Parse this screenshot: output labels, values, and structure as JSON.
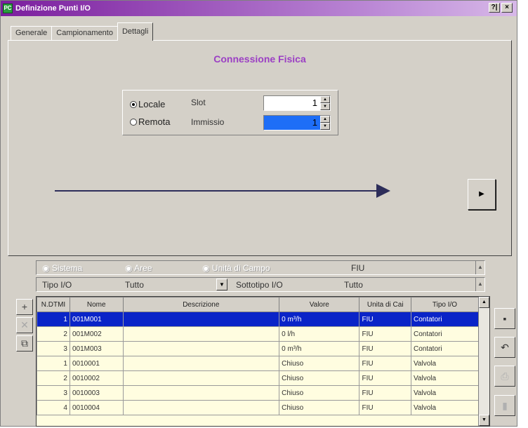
{
  "window": {
    "title": "Definizione Punti I/O",
    "help_label": "?|",
    "close_label": "×"
  },
  "tabs": [
    {
      "label": "Generale"
    },
    {
      "label": "Campionamento"
    },
    {
      "label": "Dettagli"
    }
  ],
  "details": {
    "heading": "Connessione Fisica",
    "options": [
      {
        "label": "Locale",
        "checked": true
      },
      {
        "label": "Remota",
        "checked": false
      }
    ],
    "slot_label": "Slot",
    "slot_value": "1",
    "immissio_label": "Immissio",
    "immissio_value": "1"
  },
  "filters": {
    "scope_options": [
      "Sistema",
      "Aree",
      "Unità di Campo"
    ],
    "scope_value": "FIU",
    "tipo_label": "Tipo I/O",
    "tipo_value": "Tutto",
    "sottotipo_label": "Sottotipo I/O",
    "sottotipo_value": "Tutto"
  },
  "grid": {
    "columns": [
      "N.DTMI",
      "Nome",
      "Descrizione",
      "Valore",
      "Unita di Cai",
      "Tipo I/O"
    ],
    "rows": [
      {
        "n": "1",
        "nome": "001M001",
        "descrizione": "",
        "valore": "0 m³/h",
        "unita": "FIU",
        "tipo": "Contatori"
      },
      {
        "n": "2",
        "nome": "001M002",
        "descrizione": "",
        "valore": "0 l/h",
        "unita": "FIU",
        "tipo": "Contatori"
      },
      {
        "n": "3",
        "nome": "001M003",
        "descrizione": "",
        "valore": "0 m³/h",
        "unita": "FIU",
        "tipo": "Contatori"
      },
      {
        "n": "1",
        "nome": "0010001",
        "descrizione": "",
        "valore": "Chiuso",
        "unita": "FIU",
        "tipo": "Valvola"
      },
      {
        "n": "2",
        "nome": "0010002",
        "descrizione": "",
        "valore": "Chiuso",
        "unita": "FIU",
        "tipo": "Valvola"
      },
      {
        "n": "3",
        "nome": "0010003",
        "descrizione": "",
        "valore": "Chiuso",
        "unita": "FIU",
        "tipo": "Valvola"
      },
      {
        "n": "4",
        "nome": "0010004",
        "descrizione": "",
        "valore": "Chiuso",
        "unita": "FIU",
        "tipo": "Valvola"
      }
    ],
    "selected_index": 0
  },
  "colors": {
    "accent": "#9b3fc4",
    "selection": "#0a24c8",
    "title_bar": "#7b1e9e",
    "grid_bg": "#fffde0"
  }
}
